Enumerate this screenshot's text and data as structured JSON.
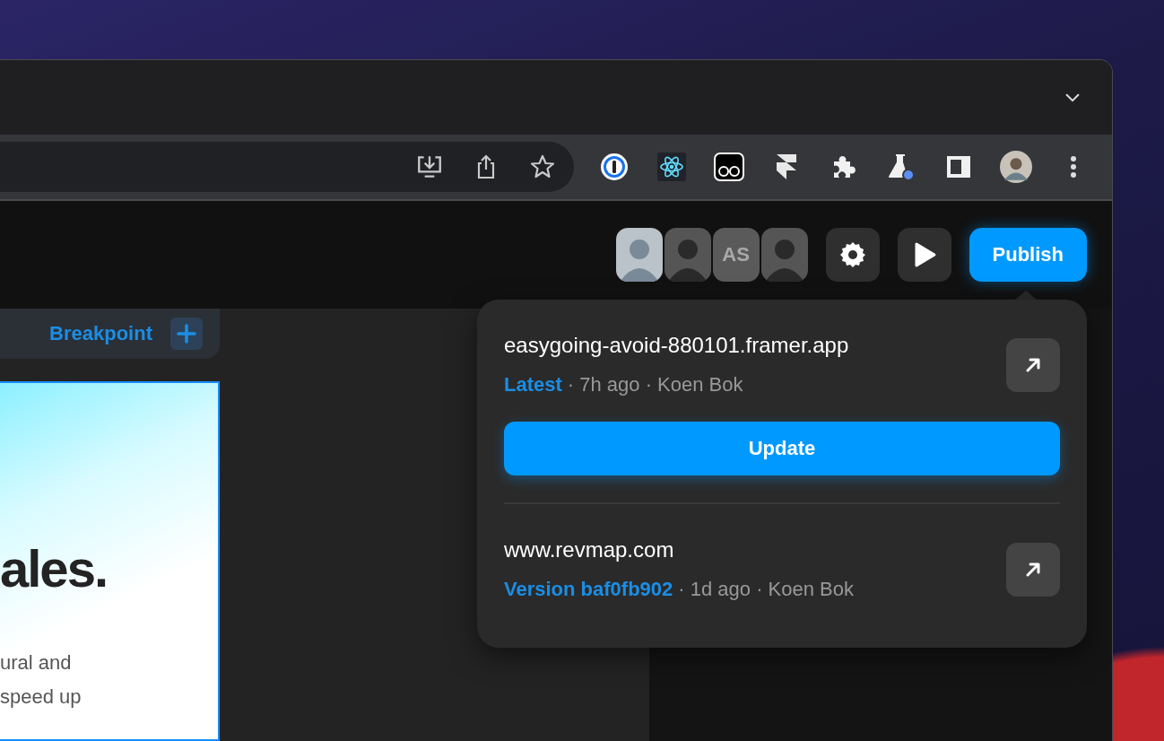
{
  "app_topbar": {
    "collaborators": [
      {
        "kind": "photo",
        "grayscale": false
      },
      {
        "kind": "photo",
        "grayscale": true
      },
      {
        "kind": "initials",
        "initials": "AS"
      },
      {
        "kind": "photo",
        "grayscale": true
      }
    ],
    "publish_button": "Publish"
  },
  "canvas": {
    "breakpoint_label": "Breakpoint",
    "heading": "ales.",
    "body_lines": [
      "ural and",
      "speed up"
    ]
  },
  "publish_popover": {
    "sites": [
      {
        "domain": "easygoing-avoid-880101.framer.app",
        "version": "Latest",
        "details": "· 7h ago · Koen Bok",
        "update_button": "Update"
      },
      {
        "domain": "www.revmap.com",
        "version": "Version baf0fb902",
        "details": "· 1d ago · Koen Bok"
      }
    ]
  }
}
